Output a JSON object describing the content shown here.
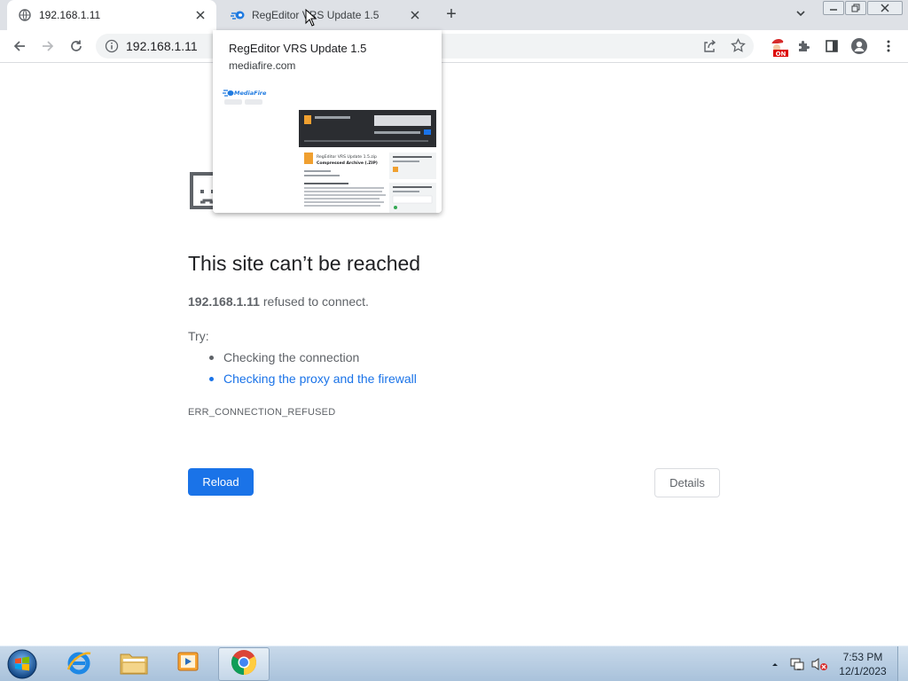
{
  "browser": {
    "tabs": [
      {
        "title": "192.168.1.11",
        "active": true,
        "favicon": "globe-icon"
      },
      {
        "title": "RegEditor VRS Update 1.5",
        "active": false,
        "favicon": "mediafire-icon"
      }
    ],
    "new_tab_symbol": "+",
    "address": "192.168.1.11"
  },
  "hover_card": {
    "title": "RegEditor VRS Update 1.5",
    "domain": "mediafire.com",
    "preview_brand": "MediaFire",
    "preview_file_title": "RegEditor VRS Update 1.5.zip",
    "preview_file_type": "Compressed Archive (.ZIP)"
  },
  "error_page": {
    "title": "This site can’t be reached",
    "host": "192.168.1.11",
    "message": "refused to connect.",
    "try_label": "Try:",
    "suggestions": [
      {
        "text": "Checking the connection",
        "link": false
      },
      {
        "text": "Checking the proxy and the firewall",
        "link": true
      }
    ],
    "error_code": "ERR_CONNECTION_REFUSED",
    "reload_label": "Reload",
    "details_label": "Details"
  },
  "extension_badge": "ON",
  "taskbar": {
    "apps": [
      "internet-explorer",
      "file-explorer",
      "media-player",
      "chrome"
    ],
    "active_app": "chrome",
    "time": "7:53 PM",
    "date": "12/1/2023"
  },
  "colors": {
    "accent": "#1a73e8",
    "tabstrip": "#dee1e6",
    "text_secondary": "#5f6368"
  }
}
